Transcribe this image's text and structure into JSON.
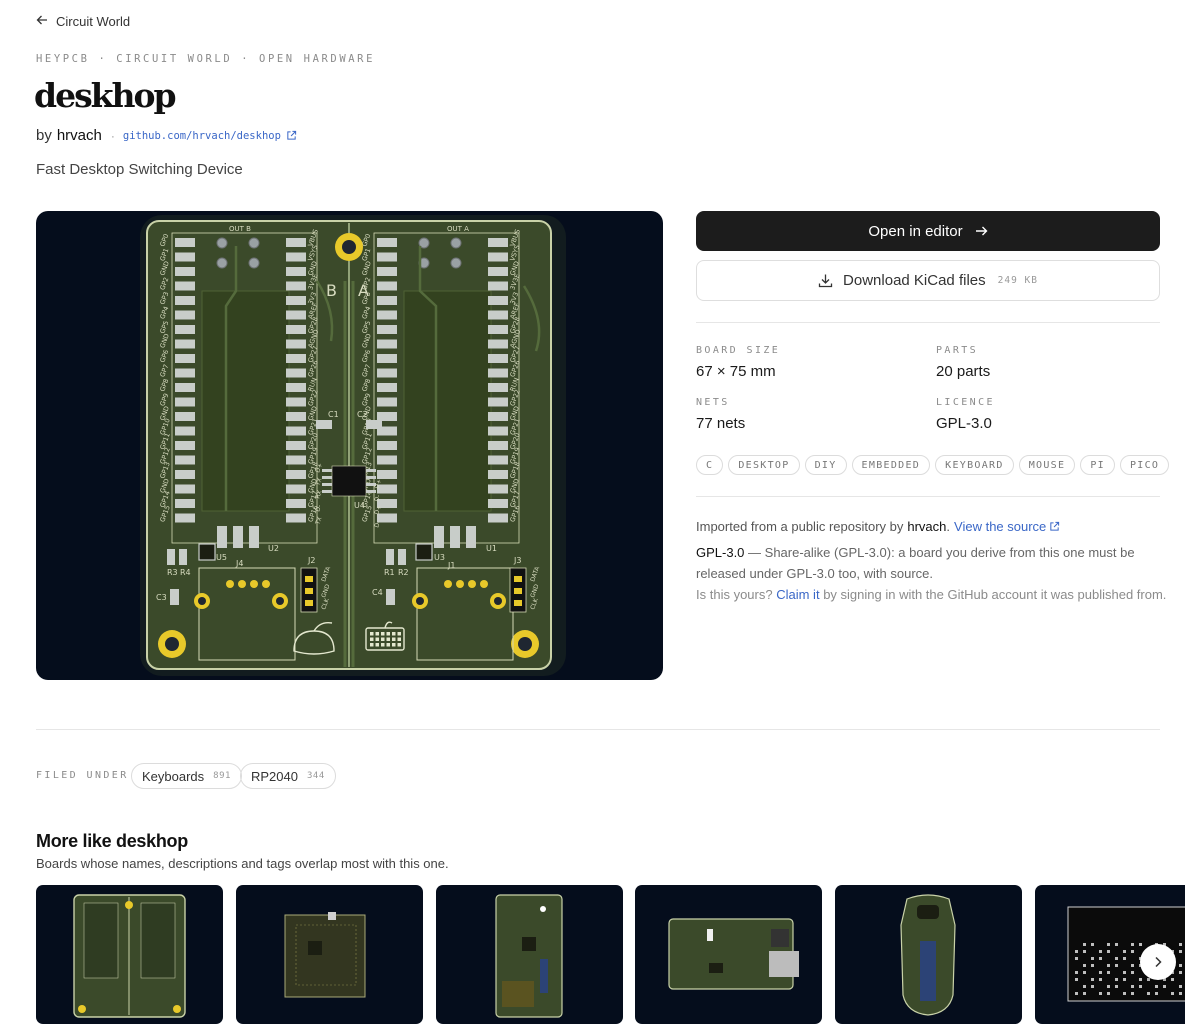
{
  "nav": {
    "back_label": "Circuit World"
  },
  "eyebrow": "HEYPCB · CIRCUIT WORLD · OPEN HARDWARE",
  "project": {
    "title": "deskhop",
    "by_prefix": "by",
    "author": "hrvach",
    "repo_link": "github.com/hrvach/deskhop",
    "description": "Fast Desktop Switching Device"
  },
  "actions": {
    "open_editor": "Open in editor",
    "download": "Download KiCad files",
    "download_size": "249 KB"
  },
  "stats": {
    "board_size_label": "BOARD SIZE",
    "board_size_value": "67 × 75 mm",
    "parts_label": "PARTS",
    "parts_value": "20 parts",
    "nets_label": "NETS",
    "nets_value": "77 nets",
    "licence_label": "LICENCE",
    "licence_value": "GPL-3.0"
  },
  "tags": [
    "C",
    "DESKTOP",
    "DIY",
    "EMBEDDED",
    "KEYBOARD",
    "MOUSE",
    "PI",
    "PICO"
  ],
  "import": {
    "prefix": "Imported from a public repository by",
    "author": "hrvach",
    "period": ".",
    "view_source": "View the source",
    "licence_name": "GPL-3.0",
    "licence_text": " — Share-alike (GPL-3.0): a board you derive from this one must be released under GPL-3.0 too, with source.",
    "claim_prefix": "Is this yours?",
    "claim_link": "Claim it",
    "claim_suffix": "by signing in with the GitHub account it was published from."
  },
  "pcb_labels": {
    "out_b": "OUT B",
    "out_a": "OUT A",
    "b": "B",
    "a": "A",
    "c1": "C1",
    "c2": "C2",
    "c3": "C3",
    "c4": "C4",
    "u1": "U1",
    "u2": "U2",
    "u3": "U3",
    "u4": "U4",
    "u5": "U5",
    "r1": "R1",
    "r2": "R2",
    "r3": "R3",
    "r4": "R4",
    "j1": "J1",
    "j2": "J2",
    "j3": "J3",
    "j4": "J4",
    "data": "DATA",
    "gnd": "GND",
    "clk": "CLK"
  },
  "pico_left_pins": [
    "GP0",
    "GP1",
    "GND",
    "GP2",
    "GP3",
    "GP4",
    "GP5",
    "GND",
    "GP6",
    "GP7",
    "GP8",
    "GP9",
    "GND",
    "GP10",
    "GP11",
    "GP12",
    "GP13",
    "GND",
    "GP14",
    "GP15"
  ],
  "pico_right_pins": [
    "VBUS",
    "VSYS",
    "GND",
    "3V3E",
    "3V3",
    "AREF",
    "GP28",
    "AGND",
    "GP27",
    "GP26",
    "RUN",
    "GP22",
    "GND",
    "GP21",
    "GP20",
    "GP19",
    "GP18",
    "GND",
    "GP17",
    "GP16"
  ],
  "u4_pins_left": [
    "D+",
    "TX",
    "RX",
    "D-",
    "TX"
  ],
  "u4_pins_right": [
    "D+",
    "D-",
    "D+",
    "D-"
  ],
  "filed_under": {
    "label": "FILED UNDER",
    "categories": [
      {
        "name": "Keyboards",
        "count": "891"
      },
      {
        "name": "RP2040",
        "count": "344"
      }
    ]
  },
  "more": {
    "title": "More like deskhop",
    "subtitle": "Boards whose names, descriptions and tags overlap most with this one."
  },
  "colors": {
    "board_bg": "#050d1c",
    "pcb_green": "#3b4a2a",
    "copper_gold": "#e8c92a",
    "link_blue": "#3a67c7",
    "primary_button": "#1c1c1c"
  }
}
